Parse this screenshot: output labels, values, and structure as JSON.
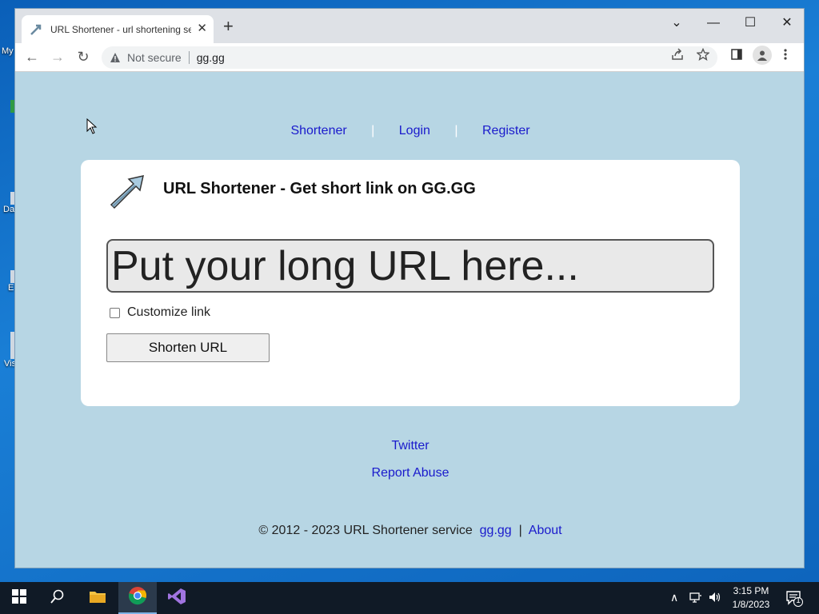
{
  "desktop": {
    "fragments": [
      "My",
      "Da",
      "E",
      "Vis"
    ]
  },
  "browser": {
    "tab": {
      "title": "URL Shortener - url shortening se",
      "close": "✕"
    },
    "new_tab": "+",
    "window_controls": {
      "dropdown": "⌄",
      "minimize": "—",
      "maximize": "☐",
      "close": "✕"
    },
    "toolbar": {
      "back": "←",
      "forward": "→",
      "reload": "↻",
      "security_label": "Not secure",
      "url": "gg.gg"
    }
  },
  "page": {
    "nav": {
      "shortener": "Shortener",
      "login": "Login",
      "register": "Register",
      "pipe": "|"
    },
    "card": {
      "title": "URL Shortener - Get short link on GG.GG",
      "url_placeholder": "Put your long URL here...",
      "customize_label": "Customize link",
      "customize_checked": false,
      "shorten_button": "Shorten URL"
    },
    "footer": {
      "twitter": "Twitter",
      "report_abuse": "Report Abuse",
      "copyright_text": "© 2012 - 2023 URL Shortener service",
      "site_link": "gg.gg",
      "pipe": "|",
      "about": "About"
    }
  },
  "taskbar": {
    "time": "3:15 PM",
    "date": "1/8/2023",
    "notification_count": "1",
    "tray_chevron": "∧"
  },
  "colors": {
    "page_bg": "#b7d6e4",
    "link": "#1a1acc",
    "taskbar": "#101a26"
  }
}
